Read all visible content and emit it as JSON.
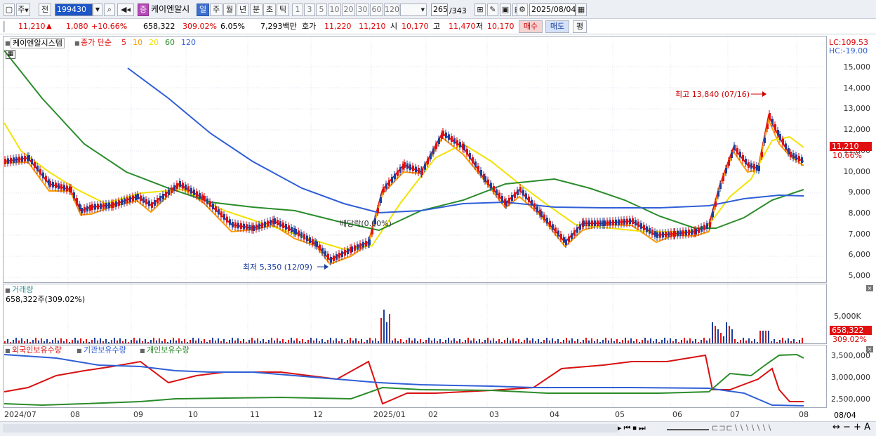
{
  "toolbar": {
    "type_label": "주",
    "prev_label": "전",
    "code_value": "199430",
    "stock_name": "케이엔알시",
    "badge_label": "증",
    "periods": [
      "일",
      "주",
      "월",
      "년",
      "분",
      "초",
      "틱"
    ],
    "active_period": "일",
    "multipliers": [
      "1",
      "3",
      "5",
      "10",
      "20",
      "30",
      "60",
      "120"
    ],
    "count_value": "265",
    "count_total": "/343",
    "date_value": "2025/08/04"
  },
  "quote": {
    "price": "11,210",
    "change": "1,080",
    "change_pct": "+10.66%",
    "volume": "658,322",
    "volume_ratio": "309.02%",
    "turnover": "6.05%",
    "amount": "7,293백만",
    "ask_label": "호가",
    "ask1": "11,220",
    "ask2": "11,210",
    "open_label": "시",
    "open": "10,170",
    "high_label": "고",
    "high": "11,470",
    "low_label": "저",
    "low": "10,170",
    "buy_label": "매수",
    "sell_label": "매도",
    "eval_label": "평"
  },
  "price_panel": {
    "name_tag": "케이엔알시스템",
    "ma_label": "종가 단순",
    "ma_periods": [
      "5",
      "10",
      "20",
      "60",
      "120"
    ],
    "ma_colors": [
      "#e01010",
      "#ff9a00",
      "#f2e200",
      "#2a8c2a",
      "#2f5fd6"
    ],
    "lc": "LC:109.53",
    "hc": "HC:-19.00",
    "y_ticks": [
      "15,000",
      "14,000",
      "13,000",
      "12,000",
      "11,000",
      "10,000",
      "9,000",
      "8,000",
      "7,000",
      "6,000",
      "5,000"
    ],
    "price_tag": "11,210",
    "pct_tag": "10.66%",
    "high_note": "최고 13,840 (07/16)",
    "low_note": "최저 5,350 (12/09)",
    "dividend_note": "배당락(0.00%)"
  },
  "volume_panel": {
    "title": "거래량",
    "value": "658,322주(309.02%)",
    "y_tick": "5,000K",
    "tag_value": "658,322",
    "tag_pct": "309.02%"
  },
  "holding_panel": {
    "legend": [
      "외국인보유수량",
      "기관보유수량",
      "개인보유수량"
    ],
    "legend_colors": [
      "#d81010",
      "#2f5fd6",
      "#2a8c2a"
    ],
    "y_ticks": [
      "3,500,000",
      "3,000,000",
      "2,500,000"
    ]
  },
  "x_axis": {
    "labels": [
      "2024/07",
      "08",
      "09",
      "10",
      "11",
      "12",
      "2025/01",
      "02",
      "03",
      "04",
      "05",
      "06",
      "07",
      "08"
    ],
    "right_label": "08/04"
  }
}
